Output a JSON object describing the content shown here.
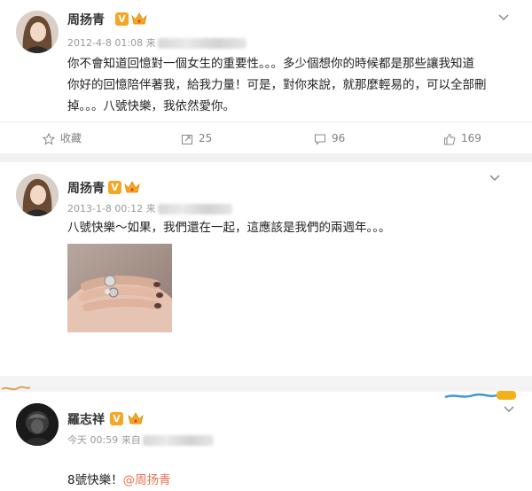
{
  "posts": [
    {
      "author": "周扬青",
      "verified_badge": "V",
      "timestamp": "2012-4-8 01:08 来",
      "text": "你不會知道回憶對一個女生的重要性。。。多少個想你的時候都是那些讓我知道\n你好的回憶陪伴著我，給我力量！可是，對你來說，就那麼輕易的，可以全部刪\n掉。。。八號快樂，我依然愛你。",
      "actions": {
        "favorite": "收藏",
        "repost": "25",
        "comment": "96",
        "like": "169"
      }
    },
    {
      "author": "周扬青",
      "verified_badge": "V",
      "timestamp": "2013-1-8 00:12 来",
      "text": "八號快樂～如果，我們還在一起，這應該是我們的兩週年。。。"
    },
    {
      "author": "羅志祥",
      "verified_badge": "V",
      "timestamp": "今天 00:59 来自",
      "text_prefix": "8號快樂！",
      "mention": "@周扬青"
    }
  ],
  "icons": [
    "star-icon",
    "repost-icon",
    "comment-icon",
    "thumbs-up-icon",
    "chevron-down-icon",
    "crown-icon"
  ],
  "colors": {
    "badge": "#f5a623",
    "mention": "#eb7350",
    "meta": "#999999"
  }
}
